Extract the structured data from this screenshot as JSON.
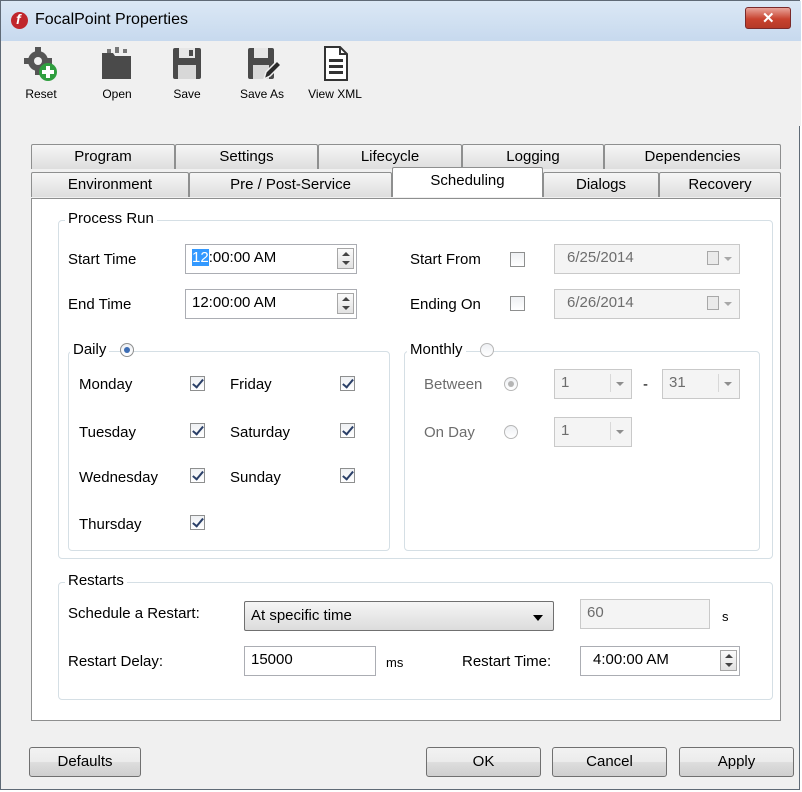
{
  "window": {
    "title": "FocalPoint Properties",
    "close_glyph": "✕"
  },
  "toolbar": {
    "reset": "Reset",
    "open": "Open",
    "save": "Save",
    "save_as": "Save As",
    "view_xml": "View XML"
  },
  "tabs": {
    "row1": [
      "Program",
      "Settings",
      "Lifecycle",
      "Logging",
      "Dependencies"
    ],
    "row2": [
      "Environment",
      "Pre / Post-Service",
      "Scheduling",
      "Dialogs",
      "Recovery"
    ],
    "active": "Scheduling"
  },
  "process_run": {
    "title": "Process Run",
    "start_time_label": "Start Time",
    "start_time_hour": "12",
    "start_time_rest": ":00:00 AM",
    "end_time_label": "End Time",
    "end_time_value": "12:00:00 AM",
    "start_from_label": "Start From",
    "start_from_date": "6/25/2014",
    "ending_on_label": "Ending On",
    "ending_on_date": "6/26/2014",
    "daily": {
      "title": "Daily",
      "days": {
        "monday": "Monday",
        "tuesday": "Tuesday",
        "wednesday": "Wednesday",
        "thursday": "Thursday",
        "friday": "Friday",
        "saturday": "Saturday",
        "sunday": "Sunday"
      }
    },
    "monthly": {
      "title": "Monthly",
      "between_label": "Between",
      "between_from": "1",
      "dash": "-",
      "between_to": "31",
      "on_day_label": "On Day",
      "on_day_value": "1"
    }
  },
  "restarts": {
    "title": "Restarts",
    "schedule_label": "Schedule a Restart:",
    "schedule_value": "At specific time",
    "seconds_value": "60",
    "seconds_unit": "s",
    "delay_label": "Restart Delay:",
    "delay_value": "15000",
    "delay_unit": "ms",
    "time_label": "Restart Time:",
    "time_value": "4:00:00 AM"
  },
  "footer": {
    "defaults": "Defaults",
    "ok": "OK",
    "cancel": "Cancel",
    "apply": "Apply"
  },
  "colors": {
    "accent": "#3d6db4",
    "title_bar": "#c7d9ee",
    "close_button": "#c8432f"
  }
}
